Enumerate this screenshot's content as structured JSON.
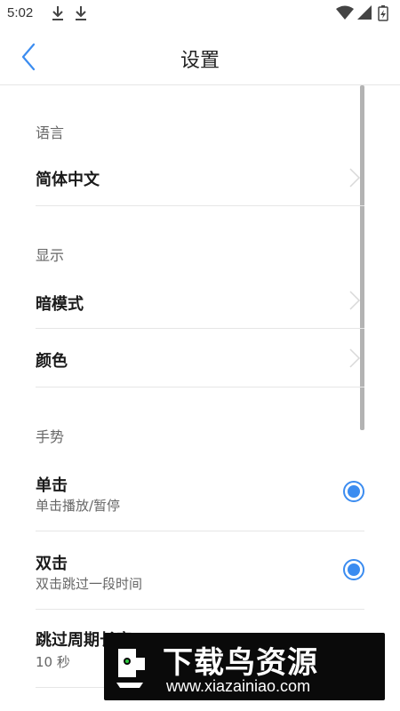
{
  "status_bar": {
    "time": "5:02",
    "icons": [
      "download-icon",
      "download-icon",
      "wifi-icon",
      "signal-icon",
      "battery-icon"
    ]
  },
  "top_bar": {
    "title": "设置",
    "back_icon": "chevron-left-icon"
  },
  "sections": {
    "language": {
      "header": "语言",
      "items": [
        {
          "title": "简体中文"
        }
      ]
    },
    "display": {
      "header": "显示",
      "items": [
        {
          "title": "暗模式"
        },
        {
          "title": "颜色"
        }
      ]
    },
    "gesture": {
      "header": "手势",
      "items": [
        {
          "title": "单击",
          "subtitle": "单击播放/暂停",
          "selected": true
        },
        {
          "title": "双击",
          "subtitle": "双击跳过一段时间",
          "selected": true
        },
        {
          "title": "跳过周期长度",
          "subtitle": "10 秒"
        }
      ]
    }
  },
  "watermark": {
    "title": "下载鸟资源",
    "url": "www.xiazainiao.com"
  },
  "colors": {
    "accent": "#3b8cf0",
    "divider": "#e6e6e6"
  }
}
